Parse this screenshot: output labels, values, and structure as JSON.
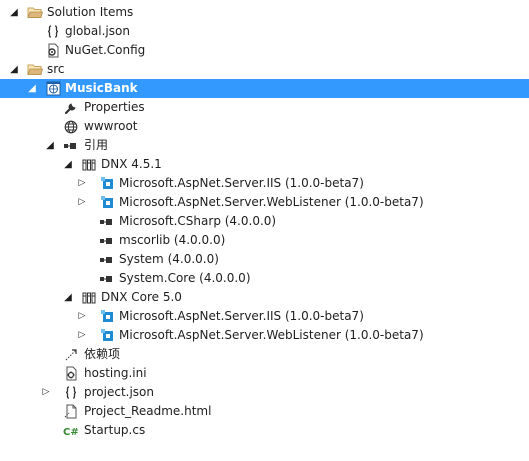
{
  "tree": {
    "solution_items": {
      "label": "Solution Items",
      "icon": "folder-open-icon",
      "expanded": true
    },
    "global_json": {
      "label": "global.json",
      "icon": "json-file-icon"
    },
    "nuget_config": {
      "label": "NuGet.Config",
      "icon": "config-file-icon"
    },
    "src": {
      "label": "src",
      "icon": "folder-open-icon",
      "expanded": true
    },
    "musicbank": {
      "label": "MusicBank",
      "icon": "web-project-icon",
      "expanded": true,
      "selected": true
    },
    "properties": {
      "label": "Properties",
      "icon": "wrench-icon"
    },
    "wwwroot": {
      "label": "wwwroot",
      "icon": "globe-icon"
    },
    "references": {
      "label": "引用",
      "icon": "references-icon",
      "expanded": true
    },
    "dnx451": {
      "label": "DNX 4.5.1",
      "icon": "framework-icon",
      "expanded": true
    },
    "dnx451_refs": [
      {
        "label": "Microsoft.AspNet.Server.IIS (1.0.0-beta7)",
        "icon": "package-icon",
        "expandable": true
      },
      {
        "label": "Microsoft.AspNet.Server.WebListener (1.0.0-beta7)",
        "icon": "package-icon",
        "expandable": true
      },
      {
        "label": "Microsoft.CSharp (4.0.0.0)",
        "icon": "assembly-icon",
        "expandable": false
      },
      {
        "label": "mscorlib (4.0.0.0)",
        "icon": "assembly-icon",
        "expandable": false
      },
      {
        "label": "System (4.0.0.0)",
        "icon": "assembly-icon",
        "expandable": false
      },
      {
        "label": "System.Core (4.0.0.0)",
        "icon": "assembly-icon",
        "expandable": false
      }
    ],
    "dnxcore50": {
      "label": "DNX Core 5.0",
      "icon": "framework-icon",
      "expanded": true
    },
    "dnxcore50_refs": [
      {
        "label": "Microsoft.AspNet.Server.IIS (1.0.0-beta7)",
        "icon": "package-icon",
        "expandable": true
      },
      {
        "label": "Microsoft.AspNet.Server.WebListener (1.0.0-beta7)",
        "icon": "package-icon",
        "expandable": true
      }
    ],
    "dependencies": {
      "label": "依赖项",
      "icon": "dependencies-icon"
    },
    "hosting_ini": {
      "label": "hosting.ini",
      "icon": "ini-file-icon"
    },
    "project_json": {
      "label": "project.json",
      "icon": "json-file-icon",
      "expandable": true
    },
    "readme": {
      "label": "Project_Readme.html",
      "icon": "html-file-icon"
    },
    "startup": {
      "label": "Startup.cs",
      "icon": "csharp-file-icon"
    }
  },
  "colors": {
    "selection": "#3399ff",
    "folder": "#dcb67a",
    "package": "#1e8bd3",
    "csharp": "#388a34",
    "text": "#1e1e1e"
  }
}
